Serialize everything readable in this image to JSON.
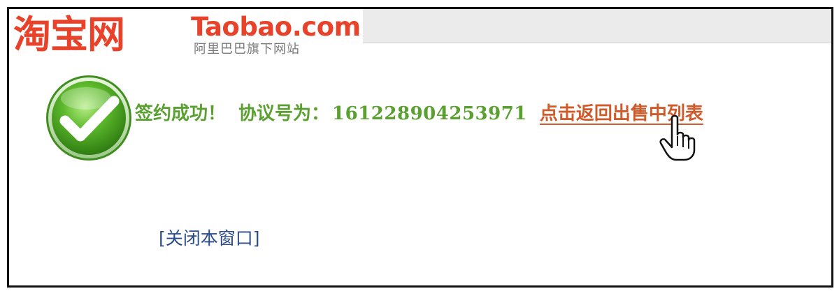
{
  "header": {
    "logo_cn": "淘宝网",
    "logo_en": "Taobao.com",
    "logo_sub": "阿里巴巴旗下网站"
  },
  "result": {
    "success_label": "签约成功！",
    "agreement_label": "协议号为：",
    "agreement_number": "161228904253971",
    "return_link": "点击返回出售中列表"
  },
  "footer": {
    "close_link": "[关闭本窗口]"
  },
  "colors": {
    "brand": "#e8432a",
    "success": "#5aa030",
    "link": "#d05a2a",
    "close_link": "#2b4c8c"
  },
  "icons": {
    "status": "check-circle-icon",
    "cursor": "hand-pointer-icon"
  }
}
